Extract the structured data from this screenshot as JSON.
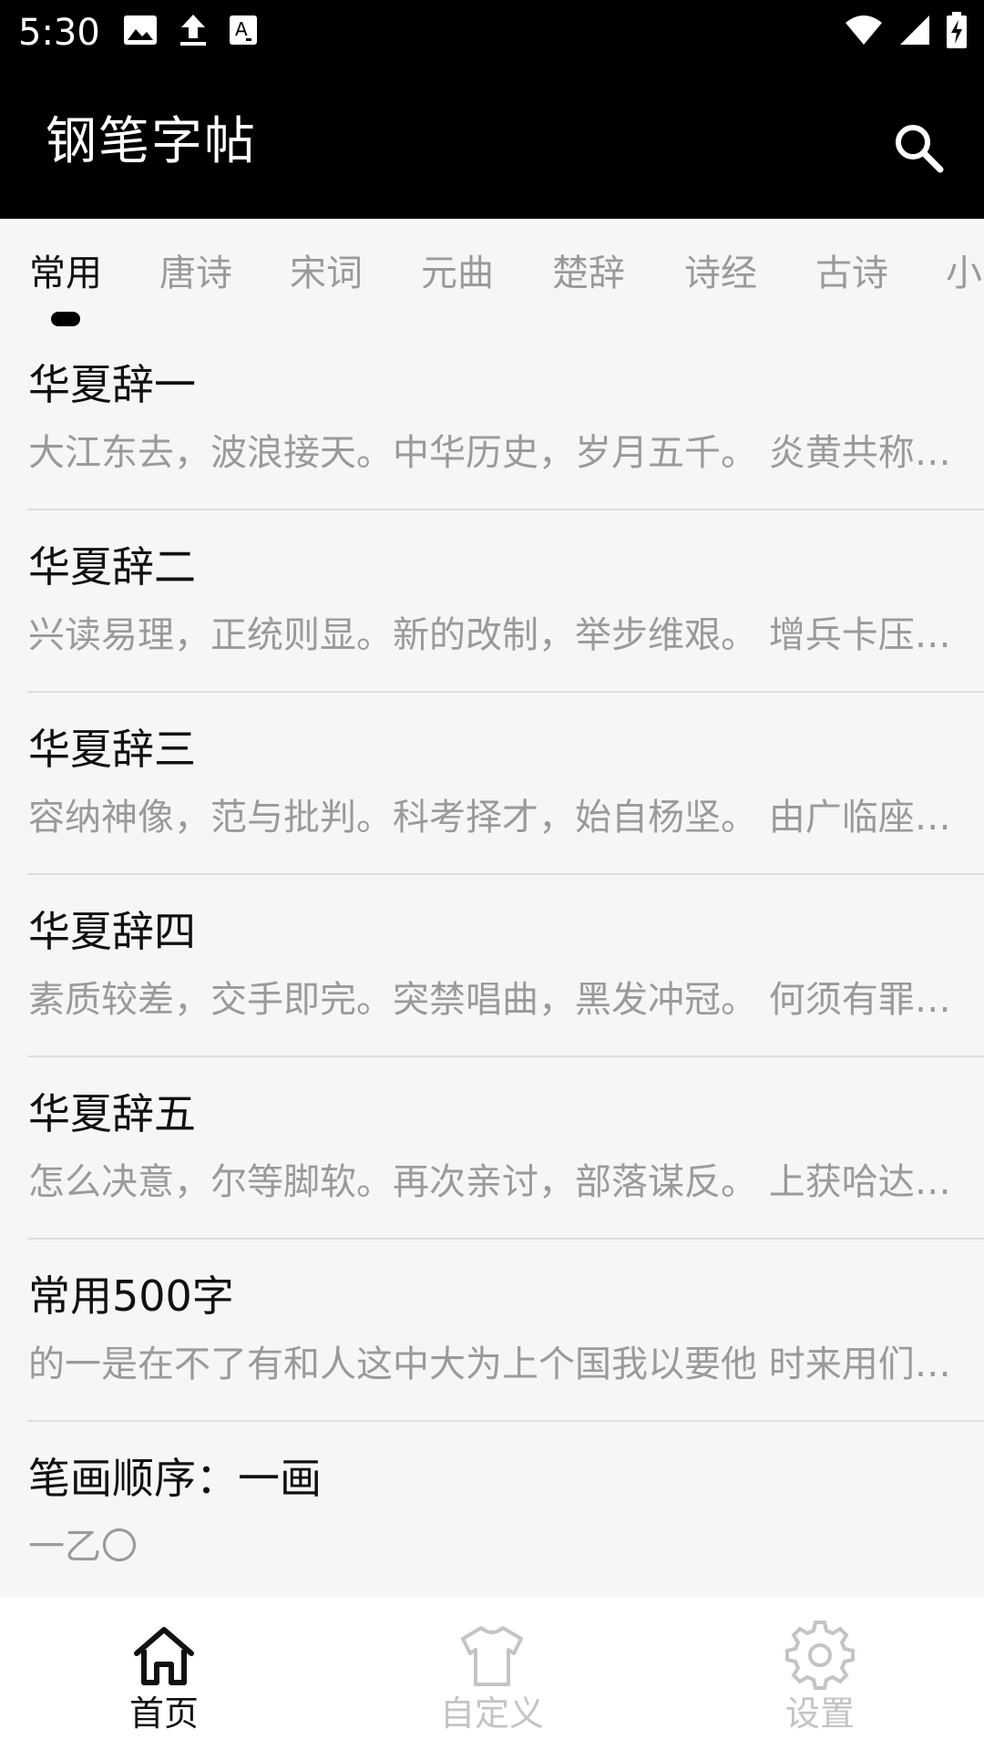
{
  "status_bar": {
    "time": "5:30",
    "left_icons": [
      "image-icon",
      "upload-icon",
      "text-notification-icon"
    ],
    "right_icons": [
      "wifi-icon",
      "signal-icon",
      "battery-charging-icon"
    ]
  },
  "app_bar": {
    "title": "钢笔字帖",
    "search_icon": "search-icon"
  },
  "tabs": [
    {
      "label": "常用",
      "active": true
    },
    {
      "label": "唐诗",
      "active": false
    },
    {
      "label": "宋词",
      "active": false
    },
    {
      "label": "元曲",
      "active": false
    },
    {
      "label": "楚辞",
      "active": false
    },
    {
      "label": "诗经",
      "active": false
    },
    {
      "label": "古诗",
      "active": false
    },
    {
      "label": "小",
      "active": false
    }
  ],
  "list": [
    {
      "title": "华夏辞一",
      "body": "大江东去，波浪接天。中华历史，岁月五千。 炎黄共称…"
    },
    {
      "title": "华夏辞二",
      "body": "兴读易理，正统则显。新的改制，举步维艰。 增兵卡压…"
    },
    {
      "title": "华夏辞三",
      "body": "容纳神像，范与批判。科考择才，始自杨坚。 由广临座…"
    },
    {
      "title": "华夏辞四",
      "body": "素质较差，交手即完。突禁唱曲，黑发冲冠。 何须有罪…"
    },
    {
      "title": "华夏辞五",
      "body": "怎么决意，尔等脚软。再次亲讨，部落谋反。 上获哈达…"
    },
    {
      "title": "常用500字",
      "body": "的一是在不了有和人这中大为上个国我以要他 时来用们…"
    },
    {
      "title": "笔画顺序：一画",
      "body": "一乙〇"
    }
  ],
  "bottom_nav": [
    {
      "label": "首页",
      "icon": "home-icon",
      "active": true
    },
    {
      "label": "自定义",
      "icon": "shirt-icon",
      "active": false
    },
    {
      "label": "设置",
      "icon": "gear-icon",
      "active": false
    }
  ],
  "colors": {
    "app_bar_bg": "#000000",
    "page_bg": "#f6f6f6",
    "text_primary": "#111111",
    "text_secondary": "#9a9a9a",
    "nav_inactive": "#c4c4c4"
  }
}
